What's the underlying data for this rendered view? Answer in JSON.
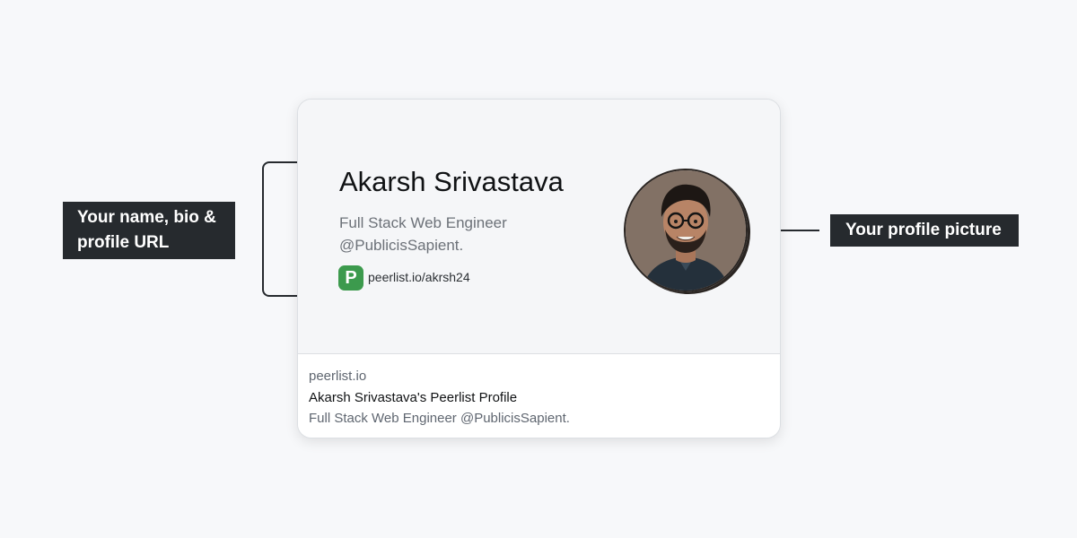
{
  "callouts": {
    "left_label": "Your name, bio & profile URL",
    "right_label": "Your profile picture"
  },
  "card": {
    "name": "Akarsh Srivastava",
    "bio": "Full Stack Web Engineer @PublicisSapient.",
    "logo_letter": "P",
    "profile_url": "peerlist.io/akrsh24",
    "footer": {
      "domain": "peerlist.io",
      "title": "Akarsh Srivastava's Peerlist Profile",
      "description": "Full Stack Web Engineer @PublicisSapient."
    }
  },
  "colors": {
    "background": "#f7f8fa",
    "callout_bg": "#262a2e",
    "peerlist_green": "#3c9a4d"
  },
  "icons": {
    "logo": "peerlist-logo-icon",
    "avatar": "profile-picture"
  }
}
